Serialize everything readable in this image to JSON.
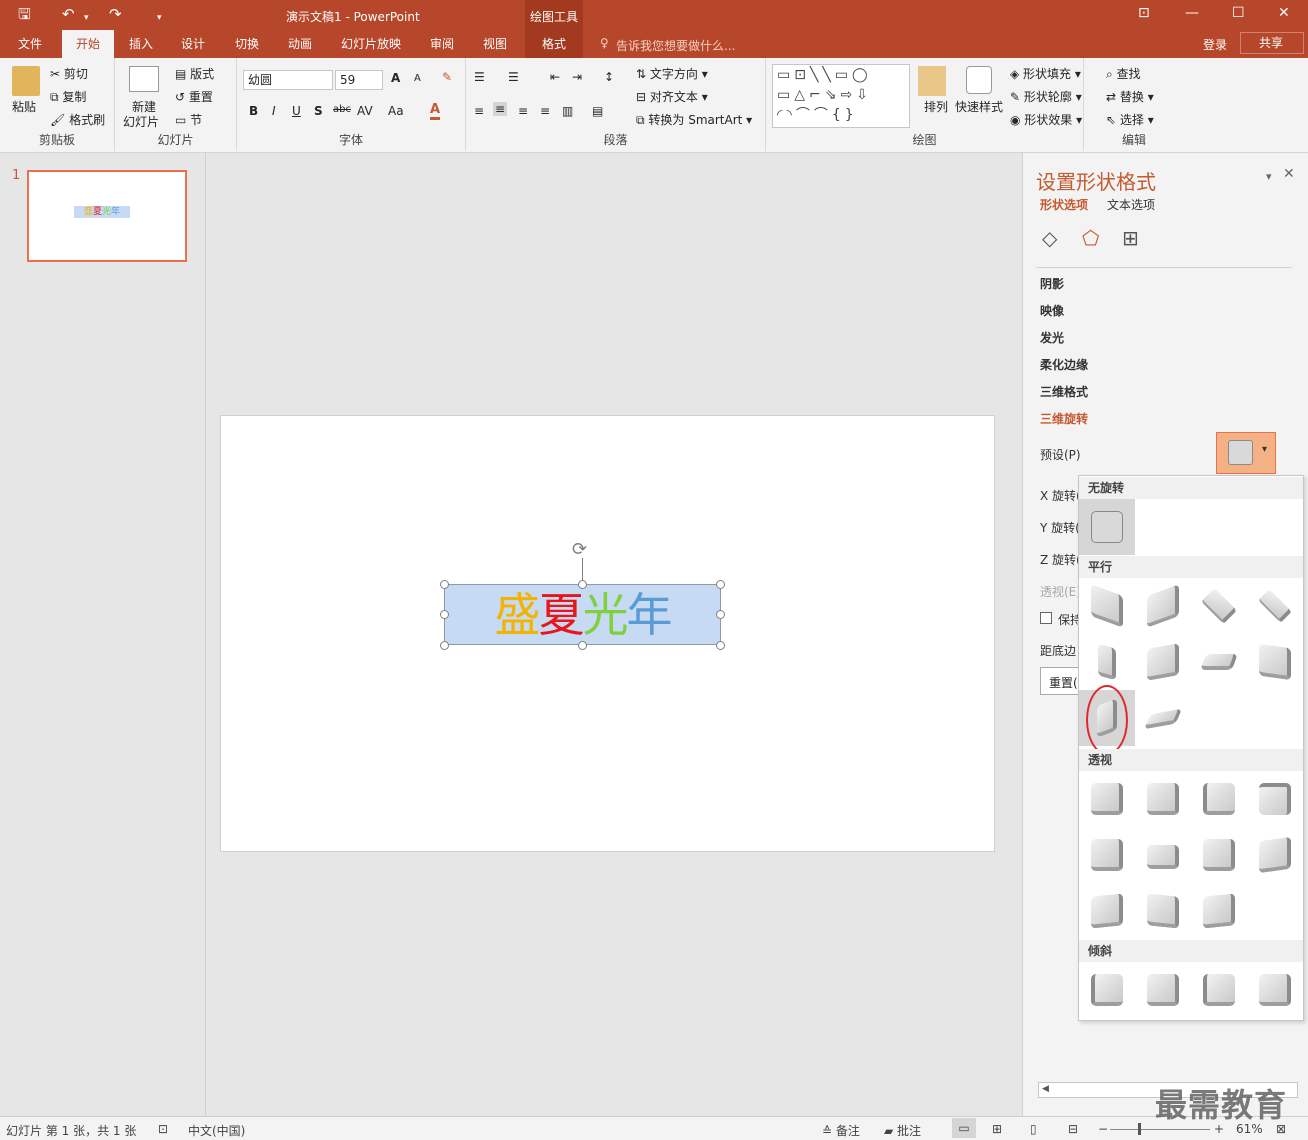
{
  "titlebar": {
    "title": "演示文稿1 - PowerPoint",
    "context_tab_group": "绘图工具",
    "qa_save": "🖫",
    "qa_undo": "↶",
    "qa_undo_dd": "▾",
    "qa_redo": "↷",
    "qa_more": "▾",
    "win_ribbon": "⊡",
    "win_min": "—",
    "win_max": "☐",
    "win_close": "✕"
  },
  "tabs": [
    "文件",
    "开始",
    "插入",
    "设计",
    "切换",
    "动画",
    "幻灯片放映",
    "审阅",
    "视图",
    "格式"
  ],
  "tellme": "告诉我您想要做什么...",
  "login": "登录",
  "share": "共享",
  "clipboard": {
    "paste": "粘贴",
    "cut": "剪切",
    "copy": "复制",
    "format_painter": "格式刷",
    "label": "剪贴板"
  },
  "slides_group": {
    "new_slide": "新建",
    "new_slide2": "幻灯片",
    "layout": "版式",
    "reset": "重置",
    "section": "节",
    "label": "幻灯片"
  },
  "font": {
    "name": "幼圆",
    "size": "59",
    "bold": "B",
    "italic": "I",
    "underline": "U",
    "shadow": "S",
    "strike": "abc",
    "spacing": "AV",
    "case": "Aa",
    "color": "A",
    "grow": "A",
    "shrink": "A",
    "label": "字体"
  },
  "paragraph": {
    "text_dir": "文字方向",
    "align_text": "对齐文本",
    "smartart": "转换为 SmartArt",
    "label": "段落"
  },
  "drawing": {
    "arrange": "排列",
    "quick_styles": "快速样式",
    "fill": "形状填充",
    "outline": "形状轮廓",
    "effects": "形状效果",
    "label": "绘图"
  },
  "editing": {
    "find": "查找",
    "replace": "替换",
    "select": "选择",
    "label": "编辑"
  },
  "thumbnail": {
    "number": "1",
    "text": "盛夏光年"
  },
  "shape_chars": [
    {
      "ch": "盛",
      "color": "#f2b400"
    },
    {
      "ch": "夏",
      "color": "#e8151b"
    },
    {
      "ch": "光",
      "color": "#7fd13b"
    },
    {
      "ch": "年",
      "color": "#5b9bd5"
    }
  ],
  "pane": {
    "title": "设置形状格式",
    "tab_shape": "形状选项",
    "tab_text": "文本选项",
    "icon_fill": "◇",
    "icon_effects": "⬠",
    "icon_size": "⊞",
    "sections": [
      "阴影",
      "映像",
      "发光",
      "柔化边缘",
      "三维格式",
      "三维旋转"
    ],
    "preset": "预设(P)",
    "x_rot": "X 旋转(",
    "y_rot": "Y 旋转(",
    "z_rot": "Z 旋转(",
    "persp": "透视(E)",
    "keep": "保持",
    "distance": "距底边",
    "reset": "重置(",
    "close": "✕",
    "menu": "▾",
    "dd": "▾"
  },
  "gallery": {
    "no_rotation": "无旋转",
    "parallel": "平行",
    "perspective": "透视",
    "oblique": "倾斜"
  },
  "status": {
    "slide": "幻灯片 第 1 张，共 1 张",
    "lang": "中文(中国)",
    "notes": "备注",
    "comments": "批注",
    "zoom": "61%"
  },
  "watermark": "最需教育"
}
